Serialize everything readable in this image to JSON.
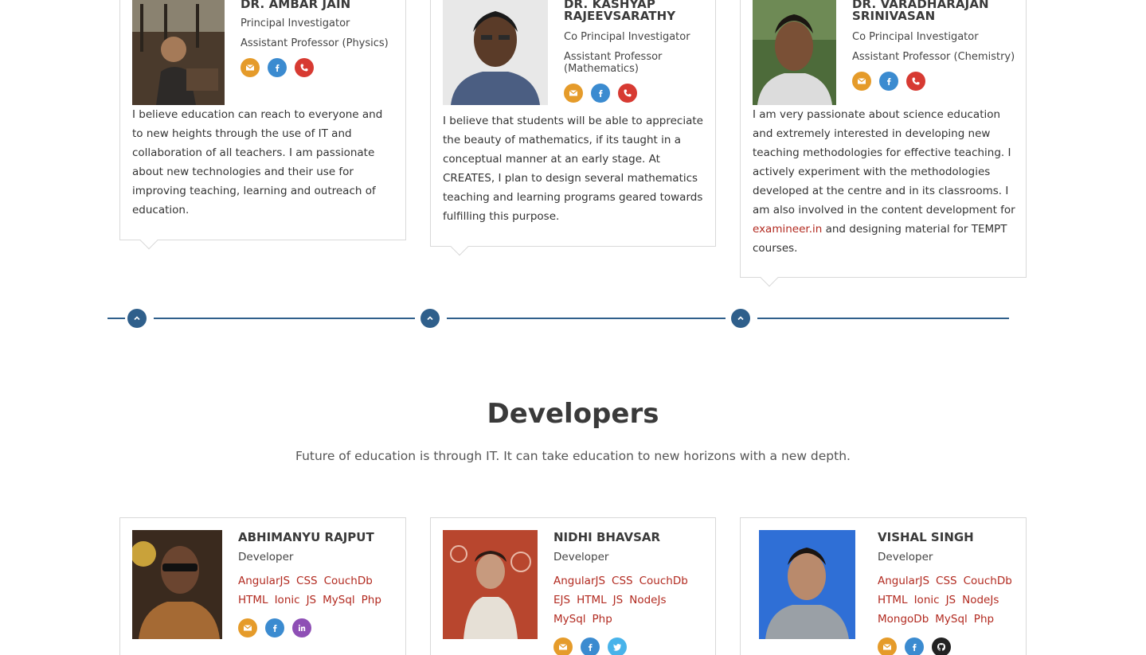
{
  "investigators": [
    {
      "name": "DR. AMBAR JAIN",
      "role": "Principal Investigator",
      "title": "Assistant Professor (Physics)",
      "bio": "I believe education can reach to everyone and to new heights through the use of IT and collaboration of all teachers. I am passionate about new technologies and their use for improving teaching, learning and outreach of education."
    },
    {
      "name_line1": "DR. KASHYAP",
      "name_line2": "RAJEEVSARATHY",
      "role": "Co Principal Investigator",
      "title_line1": "Assistant Professor",
      "title_line2": "(Mathematics)",
      "bio": "I believe that students will be able to appreciate the beauty of mathematics, if its taught in a conceptual manner at an early stage. At CREATES, I plan to design several mathematics teaching and learning programs geared towards fulfilling this purpose."
    },
    {
      "name_line1": "DR. VARADHARAJAN",
      "name_line2": "SRINIVASAN",
      "role": "Co Principal Investigator",
      "title": "Assistant Professor (Chemistry)",
      "bio_before": "I am very passionate about science education and extremely interested in developing new teaching methodologies for effective teaching. I actively experiment with the methodologies developed at the centre and in its classrooms. I am also involved in the content development for ",
      "bio_link": "examineer.in",
      "bio_after": " and designing material for TEMPT courses."
    }
  ],
  "developers_section": {
    "title": "Developers",
    "subtitle": "Future of education is through IT. It can take education to new horizons with a new depth."
  },
  "developers": [
    {
      "name": "ABHIMANYU RAJPUT",
      "role": "Developer",
      "skills": [
        "AngularJS",
        "CSS",
        "CouchDb",
        "HTML",
        "Ionic",
        "JS",
        "MySql",
        "Php"
      ],
      "socials": [
        "mail",
        "facebook",
        "linkedin"
      ]
    },
    {
      "name": "NIDHI BHAVSAR",
      "role": "Developer",
      "skills": [
        "AngularJS",
        "CSS",
        "CouchDb",
        "EJS",
        "HTML",
        "JS",
        "NodeJs",
        "MySql",
        "Php"
      ],
      "socials": [
        "mail",
        "facebook",
        "twitter"
      ]
    },
    {
      "name": "VISHAL SINGH",
      "role": "Developer",
      "skills": [
        "AngularJS",
        "CSS",
        "CouchDb",
        "HTML",
        "Ionic",
        "JS",
        "NodeJs",
        "MongoDb",
        "MySql",
        "Php"
      ],
      "socials": [
        "mail",
        "facebook",
        "github"
      ]
    }
  ],
  "colors": {
    "accent": "#2f5f8b",
    "link": "#b22a20",
    "mail": "#e59b2a",
    "facebook": "#3b8bd0",
    "phone": "#d73a32"
  }
}
